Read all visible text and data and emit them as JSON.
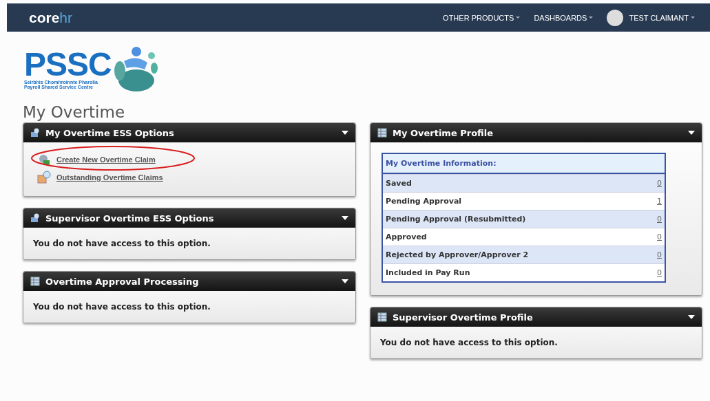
{
  "nav": {
    "logo_main": "core",
    "logo_accent": "hr",
    "items": [
      "OTHER PRODUCTS",
      "DASHBOARDS"
    ],
    "user": "TEST CLAIMANT"
  },
  "brand": {
    "acronym": "PSSC",
    "line_1": "Seirbhis Chomhroinnte Pharolla",
    "line_2": "Payroll Shared Service Centre"
  },
  "page_title": "My Overtime",
  "left_panels": [
    {
      "title": "My Overtime ESS Options",
      "kind": "links",
      "links": [
        {
          "label": "Create New Overtime Claim",
          "circled": true
        },
        {
          "label": "Outstanding Overtime Claims",
          "circled": false
        }
      ]
    },
    {
      "title": "Supervisor Overtime ESS Options",
      "kind": "message",
      "message": "You do not have access to this option."
    },
    {
      "title": "Overtime Approval Processing",
      "kind": "message",
      "message": "You do not have access to this option."
    }
  ],
  "right_panels": [
    {
      "title": "My Overtime Profile",
      "kind": "table",
      "heading": "My Overtime Information:",
      "rows": [
        {
          "label": "Saved",
          "count": "0"
        },
        {
          "label": "Pending Approval",
          "count": "1"
        },
        {
          "label": "Pending Approval (Resubmitted)",
          "count": "0"
        },
        {
          "label": "Approved",
          "count": "0"
        },
        {
          "label": "Rejected by Approver/Approver 2",
          "count": "0"
        },
        {
          "label": "Included in Pay Run",
          "count": "0"
        }
      ]
    },
    {
      "title": "Supervisor Overtime Profile",
      "kind": "message",
      "message": "You do not have access to this option."
    }
  ]
}
